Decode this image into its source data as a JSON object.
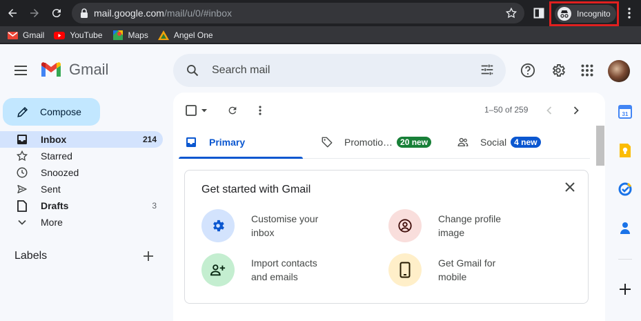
{
  "browser": {
    "url_host": "mail.google.com",
    "url_path": "/mail/u/0/#inbox",
    "incognito_label": "Incognito",
    "bookmarks": [
      {
        "label": "Gmail",
        "icon": "gmail-icon"
      },
      {
        "label": "YouTube",
        "icon": "youtube-icon"
      },
      {
        "label": "Maps",
        "icon": "maps-icon"
      },
      {
        "label": "Angel One",
        "icon": "angel-one-icon"
      }
    ]
  },
  "header": {
    "app_name": "Gmail",
    "search_placeholder": "Search mail"
  },
  "sidebar": {
    "compose_label": "Compose",
    "items": [
      {
        "label": "Inbox",
        "count": "214",
        "icon": "inbox-icon"
      },
      {
        "label": "Starred",
        "count": "",
        "icon": "star-icon"
      },
      {
        "label": "Snoozed",
        "count": "",
        "icon": "clock-icon"
      },
      {
        "label": "Sent",
        "count": "",
        "icon": "send-icon"
      },
      {
        "label": "Drafts",
        "count": "3",
        "icon": "draft-icon"
      },
      {
        "label": "More",
        "count": "",
        "icon": "chevron-down-icon"
      }
    ],
    "labels_title": "Labels"
  },
  "mail": {
    "pagination": "1–50 of 259",
    "tabs": [
      {
        "label": "Primary",
        "badge": ""
      },
      {
        "label": "Promotio…",
        "badge": "20 new",
        "badge_color": "#188038"
      },
      {
        "label": "Social",
        "badge": "4 new",
        "badge_color": "#0b57d0"
      }
    ],
    "card": {
      "title": "Get started with Gmail",
      "items": [
        {
          "line1": "Customise your",
          "line2": "inbox",
          "icon": "gear-icon",
          "color": "#d3e3fd"
        },
        {
          "line1": "Change profile",
          "line2": "image",
          "icon": "profile-icon",
          "color": "#f9dedc"
        },
        {
          "line1": "Import contacts",
          "line2": "and emails",
          "icon": "add-contact-icon",
          "color": "#c4eed0"
        },
        {
          "line1": "Get Gmail for",
          "line2": "mobile",
          "icon": "phone-icon",
          "color": "#ffefc9"
        }
      ]
    }
  },
  "colors": {
    "accent": "#0b57d0",
    "compose_bg": "#c2e7ff",
    "active_nav": "#d3e3fd",
    "incognito_highlight": "#e0201f"
  }
}
